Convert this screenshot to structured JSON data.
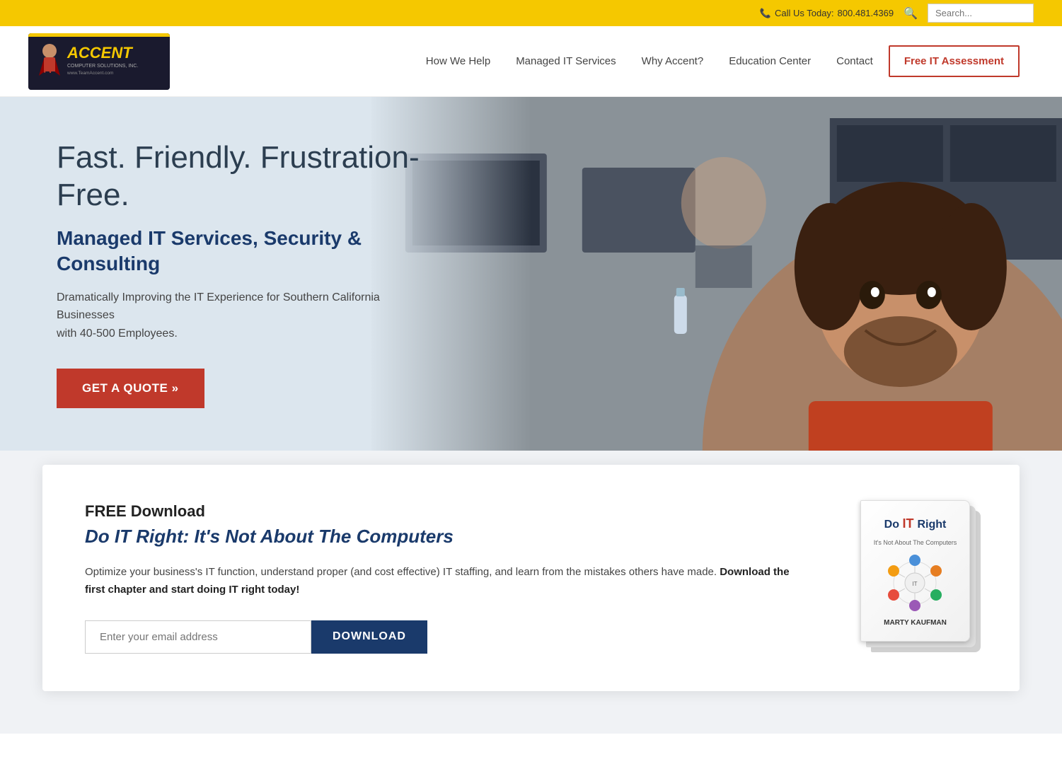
{
  "utility_bar": {
    "phone_label": "Call Us Today:",
    "phone_number": "800.481.4369",
    "search_placeholder": "Search..."
  },
  "logo": {
    "company_name": "ACCENT",
    "sub1": "COMPUTER SOLUTIONS, INC.",
    "sub2": "www.TeamAccent.com"
  },
  "nav": {
    "items": [
      {
        "label": "How We Help",
        "id": "how-we-help"
      },
      {
        "label": "Managed IT Services",
        "id": "managed-it"
      },
      {
        "label": "Why Accent?",
        "id": "why-accent"
      },
      {
        "label": "Education Center",
        "id": "education"
      },
      {
        "label": "Contact",
        "id": "contact"
      }
    ],
    "cta_label": "Free IT Assessment"
  },
  "hero": {
    "headline": "Fast. Friendly. Frustration-Free.",
    "subheadline": "Managed IT Services, Security & Consulting",
    "description": "Dramatically Improving the IT Experience for Southern California Businesses\nwith 40-500 Employees.",
    "cta_label": "GET A QUOTE »"
  },
  "download": {
    "free_label": "FREE Download",
    "title": "Do IT Right: It's Not About The Computers",
    "description": "Optimize your business's IT function, understand proper (and cost effective) IT staffing, and learn from the mistakes others have made.",
    "description_bold": "Download the first chapter and start doing IT right today!",
    "email_placeholder": "Enter your email address",
    "button_label": "DOWNLOAD",
    "book": {
      "title_line1": "Do",
      "title_it": "IT",
      "title_line2": "Right",
      "subtitle": "It's Not About The Computers",
      "author": "MARTY KAUFMAN"
    }
  }
}
